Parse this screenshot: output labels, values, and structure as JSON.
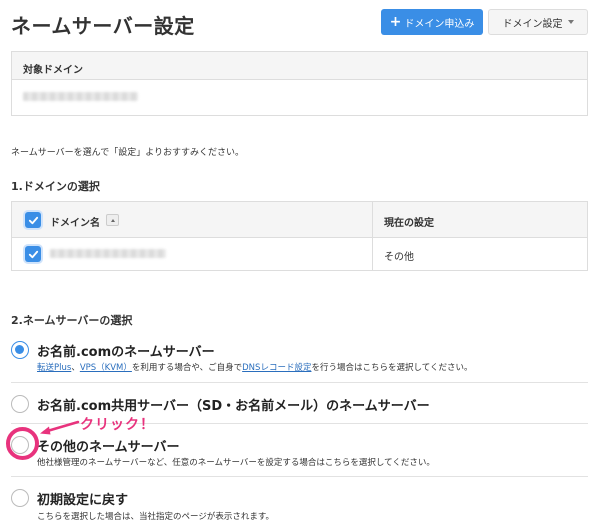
{
  "header": {
    "title": "ネームサーバー設定",
    "add_domain_label": "ドメイン申込み",
    "domain_settings_label": "ドメイン設定"
  },
  "target_domain": {
    "heading": "対象ドメイン"
  },
  "intro_text": "ネームサーバーを選んで「設定」よりおすすみください。",
  "domain_section": {
    "title": "1.ドメインの選択",
    "col_name": "ドメイン名",
    "col_current": "現在の設定",
    "rows": [
      {
        "current": "その他"
      }
    ]
  },
  "ns_section": {
    "title": "2.ネームサーバーの選択",
    "options": [
      {
        "label": "お名前.comのネームサーバー",
        "desc_parts": [
          "転送Plus",
          "、",
          "VPS（KVM）",
          "を利用する場合や、ご自身で",
          "DNSレコード設定",
          "を行う場合はこちらを選択してください。"
        ],
        "checked": true
      },
      {
        "label": "お名前.com共用サーバー（SD・お名前メール）のネームサーバー",
        "checked": false
      },
      {
        "label": "その他のネームサーバー",
        "desc": "他社様管理のネームサーバーなど、任意のネームサーバーを設定する場合はこちらを選択してください。",
        "checked": false
      },
      {
        "label": "初期設定に戻す",
        "desc": "こちらを選択した場合は、当社指定のページが表示されます。",
        "checked": false
      }
    ]
  },
  "annotation": {
    "text": "クリック！",
    "color": "#e8337d"
  },
  "colors": {
    "accent": "#3a8ee6",
    "link": "#2a6ebd"
  }
}
